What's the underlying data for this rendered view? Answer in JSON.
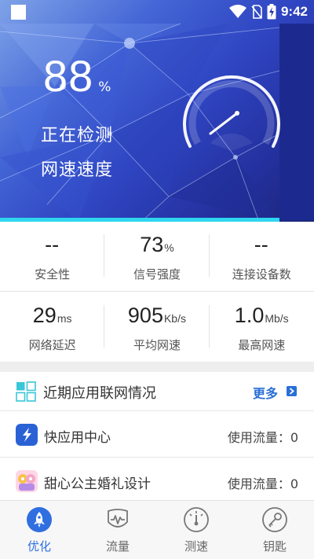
{
  "status_bar": {
    "time": "9:42"
  },
  "hero": {
    "progress_value": "88",
    "progress_unit": "%",
    "status_line1": "正在检测",
    "status_line2": "网速速度"
  },
  "stats": [
    {
      "value": "--",
      "unit": "",
      "label": "安全性"
    },
    {
      "value": "73",
      "unit": "%",
      "label": "信号强度"
    },
    {
      "value": "--",
      "unit": "",
      "label": "连接设备数"
    },
    {
      "value": "29",
      "unit": "ms",
      "label": "网络延迟"
    },
    {
      "value": "905",
      "unit": "Kb/s",
      "label": "平均网速"
    },
    {
      "value": "1.0",
      "unit": "Mb/s",
      "label": "最高网速"
    }
  ],
  "apps_section": {
    "title": "近期应用联网情况",
    "more_label": "更多",
    "apps": [
      {
        "name": "快应用中心",
        "usage": "使用流量：0",
        "icon": "quick-app-icon"
      },
      {
        "name": "甜心公主婚礼设计",
        "usage": "使用流量：0",
        "icon": "game-app-icon"
      }
    ]
  },
  "nav": {
    "items": [
      {
        "label": "优化",
        "icon": "rocket-icon",
        "active": true
      },
      {
        "label": "流量",
        "icon": "traffic-icon",
        "active": false
      },
      {
        "label": "测速",
        "icon": "speedometer-icon",
        "active": false
      },
      {
        "label": "钥匙",
        "icon": "key-icon",
        "active": false
      }
    ]
  },
  "colors": {
    "accent": "#2f6fe0",
    "hero_dark": "#1c2a8f",
    "hero_bar": "#2ed7ef"
  }
}
